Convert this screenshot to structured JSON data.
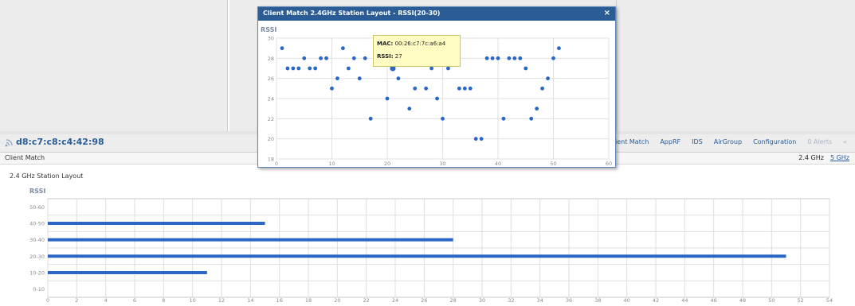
{
  "popup": {
    "title": "Client Match  2.4GHz Station Layout - RSSI(20-30)",
    "close_symbol": "×",
    "chart_data": {
      "type": "scatter",
      "ylabel": "RSSI",
      "xlim": [
        0,
        60
      ],
      "ylim": [
        18,
        30
      ],
      "x_ticks": [
        "0",
        "10",
        "20",
        "30",
        "40",
        "50",
        "60"
      ],
      "y_ticks": [
        "18",
        "20",
        "22",
        "24",
        "26",
        "28",
        "30"
      ],
      "color": "#2a67c5",
      "points": [
        [
          1,
          29
        ],
        [
          2,
          27
        ],
        [
          3,
          27
        ],
        [
          4,
          27
        ],
        [
          5,
          28
        ],
        [
          6,
          27
        ],
        [
          7,
          27
        ],
        [
          8,
          28
        ],
        [
          9,
          28
        ],
        [
          10,
          25
        ],
        [
          11,
          26
        ],
        [
          12,
          29
        ],
        [
          13,
          27
        ],
        [
          14,
          28
        ],
        [
          15,
          26
        ],
        [
          16,
          28
        ],
        [
          17,
          22
        ],
        [
          20,
          24
        ],
        [
          21,
          27
        ],
        [
          22,
          26
        ],
        [
          24,
          23
        ],
        [
          25,
          25
        ],
        [
          27,
          25
        ],
        [
          28,
          27
        ],
        [
          29,
          24
        ],
        [
          30,
          22
        ],
        [
          31,
          27
        ],
        [
          33,
          25
        ],
        [
          34,
          25
        ],
        [
          35,
          25
        ],
        [
          36,
          20
        ],
        [
          37,
          20
        ],
        [
          38,
          28
        ],
        [
          39,
          28
        ],
        [
          40,
          28
        ],
        [
          41,
          22
        ],
        [
          42,
          28
        ],
        [
          43,
          28
        ],
        [
          44,
          28
        ],
        [
          45,
          27
        ],
        [
          46,
          22
        ],
        [
          47,
          23
        ],
        [
          48,
          25
        ],
        [
          49,
          26
        ],
        [
          50,
          28
        ],
        [
          51,
          29
        ]
      ],
      "highlight": [
        21,
        27
      ]
    },
    "tooltip": {
      "mac_label": "MAC:",
      "mac_value": "00:26:c7:7c:a6:a4",
      "rssi_label": "RSSI:",
      "rssi_value": "27"
    }
  },
  "device": {
    "name": "d8:c7:c8:c4:42:98",
    "tabs": [
      "ient Match",
      "AppRF",
      "IDS",
      "AirGroup",
      "Configuration"
    ],
    "alerts": "0 Alerts",
    "arrow": "«"
  },
  "subheader": {
    "title": "Client Match",
    "band_active": "2.4 GHz",
    "band_link": "5 GHz"
  },
  "section": {
    "title": "2.4 GHz Station Layout"
  },
  "chart_data": {
    "type": "bar",
    "orientation": "horizontal",
    "ylabel": "RSSI",
    "categories": [
      "50-60",
      "40-50",
      "30-40",
      "20-30",
      "10-20",
      "0-10"
    ],
    "values": [
      0,
      15,
      28,
      51,
      11,
      0
    ],
    "xlim": [
      0,
      54
    ],
    "x_ticks": [
      "0",
      "2",
      "4",
      "6",
      "8",
      "10",
      "12",
      "14",
      "16",
      "18",
      "20",
      "22",
      "24",
      "26",
      "28",
      "30",
      "32",
      "34",
      "36",
      "38",
      "40",
      "42",
      "44",
      "46",
      "48",
      "50",
      "52",
      "54"
    ],
    "color": "#2a67c5"
  }
}
